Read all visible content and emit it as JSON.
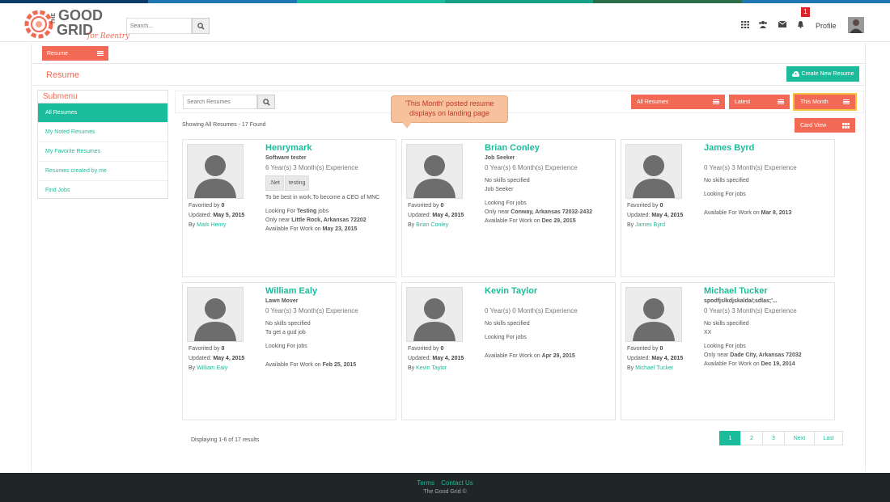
{
  "colors": {
    "accent": "#f26a55",
    "teal": "#1bbc9b",
    "footer": "#1e2626",
    "topbar": [
      "#0b3b66",
      "#1f77b4",
      "#1bbc9b",
      "#16a085",
      "#2c6e49"
    ]
  },
  "header": {
    "logo_line1": "THE",
    "logo_line2": "GOOD",
    "logo_line3": "GRID",
    "logo_tag": "for Reentry",
    "search_placeholder": "Search...",
    "notification_count": "1",
    "profile_label": "Profile"
  },
  "nav": {
    "resume_tab": "Resume"
  },
  "page": {
    "title": "Resume",
    "create_button": "Create New Resume"
  },
  "sidebar": {
    "title": "Submenu",
    "items": [
      {
        "label": "All Resumes"
      },
      {
        "label": "My Noted Resumes"
      },
      {
        "label": "My Favorite Resumes"
      },
      {
        "label": "Resumes created by me"
      },
      {
        "label": "Find Jobs"
      }
    ]
  },
  "toolbar": {
    "search_placeholder": "Search Resumes",
    "all_resumes": "All Resumes",
    "latest": "Latest",
    "this_month": "This Month",
    "card_view": "Card View"
  },
  "callout": "'This Month' posted resume displays on landing page",
  "showing": "Showing All Resumes - 17 Found",
  "cards": [
    {
      "name": "Henrymark",
      "title": "Software tester",
      "experience": "6 Year(s) 3 Month(s) Experience",
      "tags": [
        ".Net",
        "testing"
      ],
      "summary": "To be best in work.To become a CEO of MNC",
      "looking_pre": "Looking For ",
      "looking_b": "Testing",
      "looking_post": " jobs",
      "near_pre": "Only near ",
      "near_b": "Little Rock, Arkansas 72202",
      "avail_pre": "Available For Work on ",
      "avail_b": "May 23, 2015",
      "favorited_pre": "Favorited by ",
      "favorited": "0",
      "updated_pre": "Updated: ",
      "updated": "May 5, 2015",
      "by_pre": "By ",
      "by": "Mark Henry"
    },
    {
      "name": "Brian Conley",
      "title": "Job Seeker",
      "experience": "0 Year(s) 6 Month(s) Experience",
      "skills": "No skills specified",
      "summary": "Job Seeker",
      "looking": "Looking For jobs",
      "near_pre": "Only near ",
      "near_b": "Conway, Arkansas 72032-2432",
      "avail_pre": "Available For Work on ",
      "avail_b": "Dec 29, 2015",
      "favorited_pre": "Favorited by ",
      "favorited": "0",
      "updated_pre": "Updated: ",
      "updated": "May 4, 2015",
      "by_pre": "By ",
      "by": "Brian Conley"
    },
    {
      "name": "James Byrd",
      "title": "",
      "experience": "0 Year(s) 3 Month(s) Experience",
      "skills": "No skills specified",
      "looking": "Looking For jobs",
      "avail_pre": "Available For Work on ",
      "avail_b": "Mar 8, 2013",
      "favorited_pre": "Favorited by ",
      "favorited": "0",
      "updated_pre": "Updated: ",
      "updated": "May 4, 2015",
      "by_pre": "By ",
      "by": "James Byrd"
    },
    {
      "name": "William Ealy",
      "title": "Lawn Mover",
      "experience": "0 Year(s) 3 Month(s) Experience",
      "skills": "No skills specified",
      "summary": "To get a gud job",
      "looking": "Looking For jobs",
      "avail_pre": "Available For Work on ",
      "avail_b": "Feb 25, 2015",
      "favorited_pre": "Favorited by ",
      "favorited": "0",
      "updated_pre": "Updated: ",
      "updated": "May 4, 2015",
      "by_pre": "By ",
      "by": "William Ealy"
    },
    {
      "name": "Kevin Taylor",
      "title": "",
      "experience": "0 Year(s) 0 Month(s) Experience",
      "skills": "No skills specified",
      "looking": "Looking For jobs",
      "avail_pre": "Available For Work on ",
      "avail_b": "Apr 29, 2015",
      "favorited_pre": "Favorited by ",
      "favorited": "0",
      "updated_pre": "Updated: ",
      "updated": "May 4, 2015",
      "by_pre": "By ",
      "by": "Kevin Taylor"
    },
    {
      "name": "Michael Tucker",
      "title": "spodfjslkdjskalda/;sdlas;'...",
      "experience": "0 Year(s) 3 Month(s) Experience",
      "skills": "No skills specified",
      "summary": "XX",
      "looking": "Looking For jobs",
      "near_pre": "Only near ",
      "near_b": "Dade City, Arkansas 72032",
      "avail_pre": "Available For Work on ",
      "avail_b": "Dec 19, 2014",
      "favorited_pre": "Favorited by ",
      "favorited": "0",
      "updated_pre": "Updated: ",
      "updated": "May 4, 2015",
      "by_pre": "By ",
      "by": "Michael Tucker"
    }
  ],
  "pagination": {
    "pages": [
      "1",
      "2",
      "3"
    ],
    "next": "Next",
    "last": "Last",
    "summary": "Displaying 1-6 of 17 results"
  },
  "footer": {
    "terms": "Terms",
    "contact": "Contact Us",
    "copyright": "The Good Grid ©"
  }
}
